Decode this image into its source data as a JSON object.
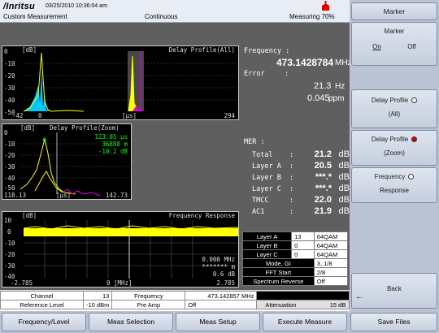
{
  "header": {
    "brand": "/Inritsu",
    "datetime": "03/25/2010 10:36:04 am",
    "mode": "Custom Measurement",
    "sweep": "Continuous",
    "status": "Measuring",
    "progress_label": "70%",
    "progress": 0.7
  },
  "graph1": {
    "unit": "[dB]",
    "title": "Delay Profile(All)",
    "yticks": [
      "0",
      "-10",
      "-20",
      "-30",
      "-40",
      "-50"
    ],
    "x_start": "-42",
    "x_mid1": "0",
    "x_unit": "[μs]",
    "x_end": "294"
  },
  "graph2": {
    "unit": "[dB]",
    "title": "Delay Profile(Zoom)",
    "yticks": [
      "0",
      "-10",
      "-20",
      "-30",
      "-40",
      "-50"
    ],
    "marker_time": "123.05 μs",
    "marker_dist": "36888 m",
    "marker_level": "-10.2 dB",
    "x_start": "118.13",
    "x_unit": "[μs]",
    "x_end": "142.73"
  },
  "graph3": {
    "unit": "[dB]",
    "title": "Frequency Response",
    "yticks": [
      "10",
      "0",
      "-10",
      "-20",
      "-30",
      "-40"
    ],
    "readout1": "0.000 MHz",
    "readout2": "******* m",
    "readout3": "0.6 dB",
    "x_start": "-2.785",
    "x_mid": "0 [MHz]",
    "x_end": "2.785"
  },
  "freq": {
    "label": "Frequency :",
    "value": "473.1428784",
    "unit": "MHz",
    "error_label": "Error",
    "error_colon": ":",
    "error_hz": "21.3",
    "error_hz_unit": "Hz",
    "error_ppm": "0.045",
    "error_ppm_unit": "ppm"
  },
  "mer": {
    "label": "MER :",
    "rows": [
      {
        "name": "Total",
        "colon": ":",
        "value": "21.2",
        "unit": "dB"
      },
      {
        "name": "Layer A",
        "colon": ":",
        "value": "20.5",
        "unit": "dB"
      },
      {
        "name": "Layer B",
        "colon": ":",
        "value": "***.*",
        "unit": "dB"
      },
      {
        "name": "Layer C",
        "colon": ":",
        "value": "***.*",
        "unit": "dB"
      },
      {
        "name": "TMCC",
        "colon": ":",
        "value": "22.0",
        "unit": "dB"
      },
      {
        "name": "AC1",
        "colon": ":",
        "value": "21.9",
        "unit": "dB"
      }
    ]
  },
  "info_table": {
    "layers": [
      {
        "label": "Layer A",
        "segments": "13",
        "modulation": "64QAM"
      },
      {
        "label": "Layer B",
        "segments": "0",
        "modulation": "64QAM"
      },
      {
        "label": "Layer C",
        "segments": "0",
        "modulation": "64QAM"
      }
    ],
    "mode_gi_label": "Mode, GI",
    "mode_gi_value": "3, 1/8",
    "fft_label": "FFT Start",
    "fft_value": "2/8",
    "spectrum_label": "Spectrum Reverse",
    "spectrum_value": "Off"
  },
  "params": {
    "channel_label": "Channel",
    "channel_value": "13",
    "frequency_label": "Frequency",
    "frequency_value": "473.142857 MHz",
    "ref_label": "Reference Level",
    "ref_value": "-10 dBm",
    "preamp_label": "Pre Amp",
    "preamp_value": "Off",
    "atten_label": "Attenuation",
    "atten_value": "15 dB"
  },
  "softkeys": {
    "title": "Marker",
    "marker": "Marker",
    "on": "On",
    "off": "Off",
    "delay_all_1": "Delay Profile",
    "delay_all_2": "(All)",
    "delay_zoom_1": "Delay Profile",
    "delay_zoom_2": "(Zoom)",
    "freq_resp_1": "Frequency",
    "freq_resp_2": "Response",
    "back": "Back"
  },
  "menubar": {
    "items": [
      "Frequency/Level",
      "Meas Selection",
      "Meas Setup",
      "Execute Measure",
      "Save Files"
    ]
  },
  "colors": {
    "trace_yellow": "#ffff00",
    "trace_cyan": "#00c8ff",
    "trace_magenta": "#e000e0",
    "marker_green": "#00ff00",
    "status_red": "#e00000"
  }
}
